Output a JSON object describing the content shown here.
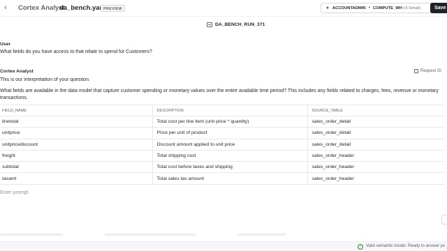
{
  "header": {
    "back_icon": "chevron-left-icon",
    "app_name": "Cortex Analyst",
    "separator": "/",
    "file_name": "da_bench.yaml",
    "badge": "PREVIEW",
    "role": "ACCOUNTADMIN",
    "context_separator": "•",
    "warehouse": "COMPUTE_WH",
    "warehouse_size": "(X-Small)",
    "save_label": "Save"
  },
  "run": {
    "icon": "document-icon",
    "title": "DA_BENCH_RUN_371"
  },
  "conversation": {
    "user_role": "User",
    "user_message": "What fields do you have access to that relate to spend for Customers?",
    "analyst_role": "Cortex Analyst",
    "request_id_label": "Request ID",
    "interpretation_intro": "This is our interpretation of your question:",
    "interpretation": "What fields are available in the data model that capture customer spending or monetary values over the entire available time period? This includes any fields related to charges, fees, revenue or monetary transactions."
  },
  "table": {
    "columns": [
      "FIELD_NAME",
      "DESCRIPTION",
      "SOURCE_TABLE"
    ],
    "rows": [
      [
        "linetotal",
        "Total cost per line item (unit price * quantity)",
        "sales_order_detail"
      ],
      [
        "unitprice",
        "Price per unit of product",
        "sales_order_detail"
      ],
      [
        "unitpricediscount",
        "Discount amount applied to unit price",
        "sales_order_detail"
      ],
      [
        "freight",
        "Total shipping cost",
        "sales_order_header"
      ],
      [
        "subtotal",
        "Total cost before taxes and shipping",
        "sales_order_header"
      ],
      [
        "taxamt",
        "Total sales tax amount",
        "sales_order_header"
      ]
    ]
  },
  "prompt": {
    "placeholder": "Enter prompt"
  },
  "status": {
    "icon": "check-circle-icon",
    "text": "Valid semantic model. Ready to answer yo"
  }
}
